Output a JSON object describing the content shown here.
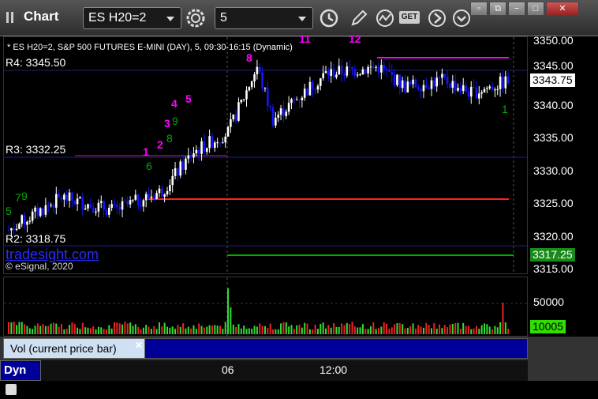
{
  "window": {
    "title": "Chart",
    "symbol": "ES H20=2",
    "interval": "5",
    "get_label": "GET"
  },
  "chart": {
    "legend": "* ES H20=2, S&P 500 FUTURES E-MINI (DAY), 5, 09:30-16:15 (Dynamic)",
    "pivots": {
      "r4": "R4: 3345.50",
      "r3": "R3: 3332.25",
      "r2": "R2: 3318.75"
    },
    "watermark": "tradesight.com",
    "copyright": "© eSignal, 2020",
    "price_ticks": [
      "3350.00",
      "3345.00",
      "3340.00",
      "3335.00",
      "3330.00",
      "3325.00",
      "3320.00",
      "3315.00"
    ],
    "last_price": "3343.75",
    "green_level": "3317.25",
    "seq_magenta": [
      "1",
      "2",
      "3",
      "4",
      "5",
      "8",
      "11",
      "12"
    ],
    "seq_green": [
      "9",
      "8",
      "6",
      "7",
      "9",
      "5",
      "1"
    ]
  },
  "volume": {
    "label": "Vol (current price bar)",
    "tick": "50000",
    "last": "10005"
  },
  "time_axis": {
    "ticks": [
      "06",
      "12:00"
    ],
    "mode": "Dyn"
  },
  "colors": {
    "up_bar": "#ffffff",
    "down_bar": "#1414ff",
    "pivot_line": "#1a1aaa",
    "red_line": "#ff2020",
    "magenta": "#ff00ff",
    "green": "#00aa00"
  }
}
